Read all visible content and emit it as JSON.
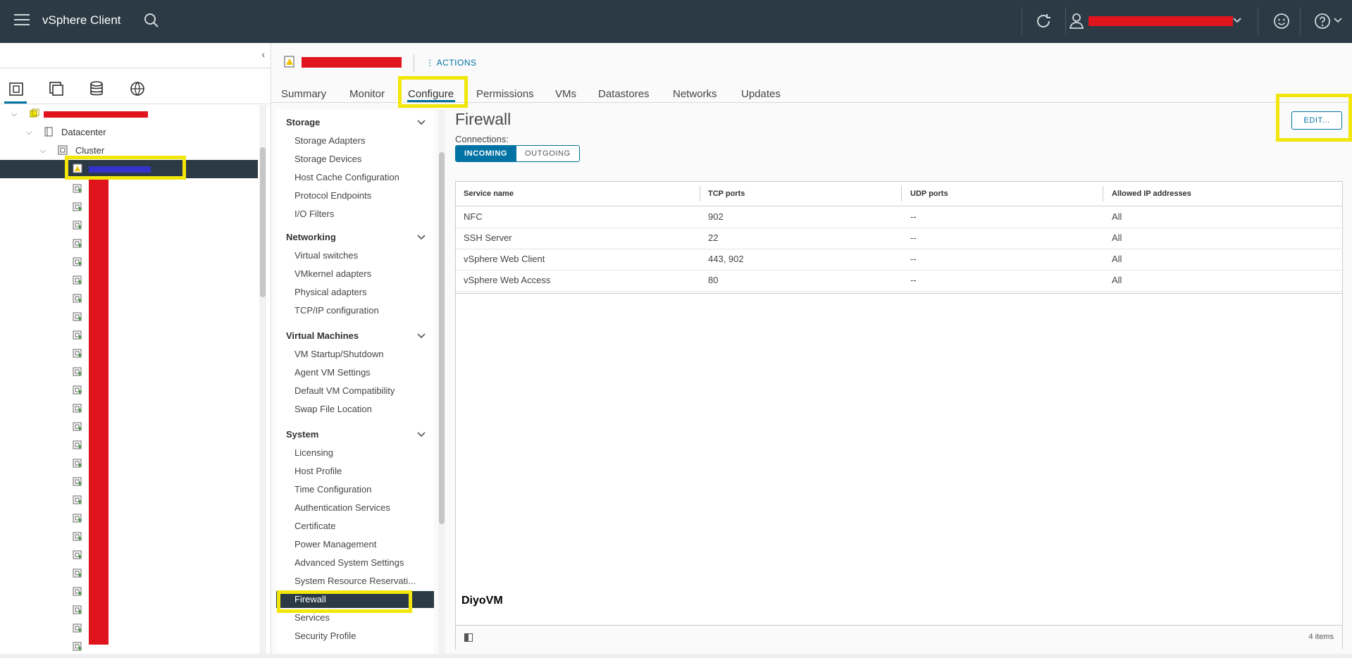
{
  "app": {
    "title": "vSphere Client"
  },
  "topbar": {
    "icons": [
      "hamburger-menu-icon",
      "search-icon",
      "refresh-icon",
      "user-icon",
      "chevron-down-icon",
      "feedback-smiley-icon",
      "help-icon"
    ]
  },
  "inventory": {
    "tabs_icons": [
      "hosts-and-clusters-icon",
      "vms-and-templates-icon",
      "storage-icon",
      "networking-icon"
    ],
    "datacenter": "Datacenter",
    "cluster": "Cluster"
  },
  "host_header": {
    "actions_label": "ACTIONS"
  },
  "tabs": [
    "Summary",
    "Monitor",
    "Configure",
    "Permissions",
    "VMs",
    "Datastores",
    "Networks",
    "Updates"
  ],
  "active_tab": "Configure",
  "subnav": {
    "groups": [
      {
        "label": "Storage",
        "items": [
          "Storage Adapters",
          "Storage Devices",
          "Host Cache Configuration",
          "Protocol Endpoints",
          "I/O Filters"
        ]
      },
      {
        "label": "Networking",
        "items": [
          "Virtual switches",
          "VMkernel adapters",
          "Physical adapters",
          "TCP/IP configuration"
        ]
      },
      {
        "label": "Virtual Machines",
        "items": [
          "VM Startup/Shutdown",
          "Agent VM Settings",
          "Default VM Compatibility",
          "Swap File Location"
        ]
      },
      {
        "label": "System",
        "items": [
          "Licensing",
          "Host Profile",
          "Time Configuration",
          "Authentication Services",
          "Certificate",
          "Power Management",
          "Advanced System Settings",
          "System Resource Reservati...",
          "Firewall",
          "Services",
          "Security Profile"
        ]
      }
    ],
    "selected": "Firewall"
  },
  "firewall": {
    "title": "Firewall",
    "connections_label": "Connections:",
    "segment_incoming": "INCOMING",
    "segment_outgoing": "OUTGOING",
    "edit_label": "EDIT...",
    "columns": [
      "Service name",
      "TCP ports",
      "UDP ports",
      "Allowed IP addresses"
    ],
    "rows": [
      [
        "NFC",
        "902",
        "--",
        "All"
      ],
      [
        "SSH Server",
        "22",
        "--",
        "All"
      ],
      [
        "vSphere Web Client",
        "443, 902",
        "--",
        "All"
      ],
      [
        "vSphere Web Access",
        "80",
        "--",
        "All"
      ]
    ],
    "item_count": "4 items"
  },
  "watermark": "DiyoVM",
  "colors": {
    "topbar": "#2b3a44",
    "accent": "#0072a3",
    "highlight": "#f2e60a",
    "redaction": "#e0141d"
  }
}
